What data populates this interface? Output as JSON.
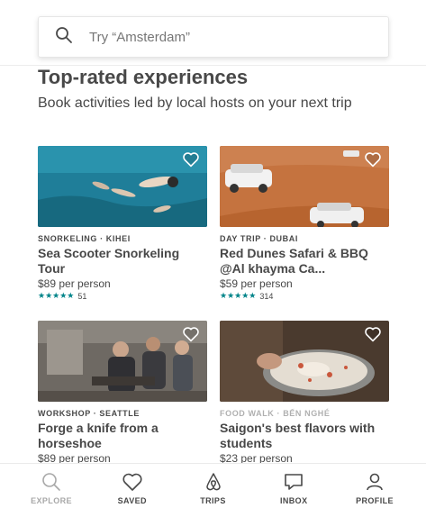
{
  "search": {
    "placeholder": "Try “Amsterdam”"
  },
  "section": {
    "title": "Top-rated experiences",
    "subtitle": "Book activities led by local hosts on your next trip"
  },
  "cards": [
    {
      "kicker": "SNORKELING · KIHEI",
      "title": "Sea Scooter Snorkeling Tour",
      "price": "$89 per person",
      "stars": "★★★★★",
      "reviews": "51"
    },
    {
      "kicker": "DAY TRIP · DUBAI",
      "title": "Red Dunes Safari & BBQ @Al khayma Ca...",
      "price": "$59 per person",
      "stars": "★★★★★",
      "reviews": "314"
    },
    {
      "kicker": "WORKSHOP · SEATTLE",
      "title": "Forge a knife from a horseshoe",
      "price": "$89 per person"
    },
    {
      "kicker": "FOOD WALK · BẾN NGHÉ",
      "title": "Saigon's best flavors with students",
      "price": "$23 per person"
    }
  ],
  "tabs": [
    {
      "label": "EXPLORE",
      "icon": "explore-search-icon",
      "active": true
    },
    {
      "label": "SAVED",
      "icon": "heart-icon"
    },
    {
      "label": "TRIPS",
      "icon": "airbnb-belo-icon"
    },
    {
      "label": "INBOX",
      "icon": "chat-bubble-icon"
    },
    {
      "label": "PROFILE",
      "icon": "person-icon"
    }
  ],
  "colors": {
    "accent": "#008489",
    "text": "#484848",
    "muted": "#767676"
  }
}
